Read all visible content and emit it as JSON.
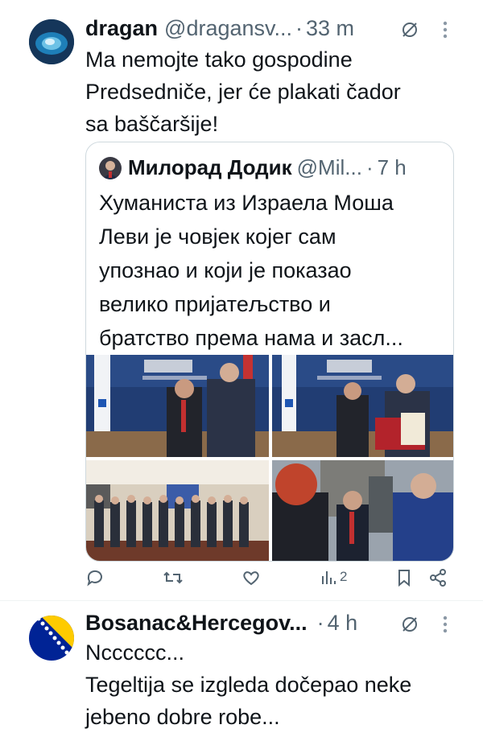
{
  "tweet1": {
    "name": "dragan",
    "handle": "@dragansv...",
    "time": "33 m",
    "text": "Ma nemojte tako gospodine\nPredsedniče, jer će plakati čador\nsa baščaršije!",
    "quote": {
      "name": "Милорад Додик",
      "handle": "@Mil...",
      "time": "7 h",
      "text": "Хуманиста из Израела Моша\nЛеви је човјек којег сам\nупознао и који је показао\nвелико пријатељство и\nбратство према нама и засл..."
    },
    "actions": {
      "views": "2"
    }
  },
  "tweet2": {
    "name": "Bosanac&Hercegov...",
    "time": "4 h",
    "text": "Ncccccc...\nTegeltija se izgleda dočepao neke\njebeno dobre robe..."
  },
  "icons": [
    "grok-icon",
    "more-icon",
    "reply-icon",
    "retweet-icon",
    "like-icon",
    "views-icon",
    "bookmark-icon",
    "share-icon"
  ],
  "colors": {
    "text": "#0f1419",
    "secondary": "#536471",
    "border": "#cfd9de"
  }
}
